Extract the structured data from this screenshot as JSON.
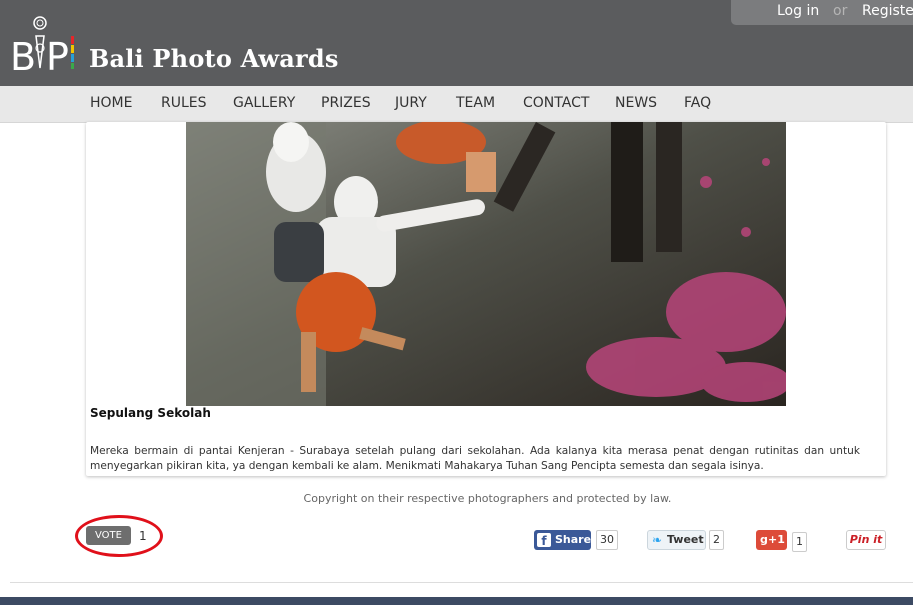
{
  "header": {
    "brand": "Bali Photo Awards",
    "login": "Log in",
    "or": "or",
    "register": "Register"
  },
  "nav": [
    "HOME",
    "RULES",
    "GALLERY",
    "PRIZES",
    "JURY",
    "TEAM",
    "CONTACT",
    "NEWS",
    "FAQ"
  ],
  "photo": {
    "title": "Sepulang Sekolah",
    "description": "Mereka bermain di pantai Kenjeran - Surabaya setelah pulang dari sekolahan. Ada kalanya kita merasa penat dengan rutinitas dan untuk menyegarkan pikiran kita, ya dengan kembali ke alam. Menikmati Mahakarya Tuhan Sang Pencipta semesta dan segala isinya."
  },
  "copyright": "Copyright on their respective photographers and protected by law.",
  "vote": {
    "label": "VOTE",
    "count": "1"
  },
  "social": {
    "facebook": {
      "label": "Share",
      "count": "30"
    },
    "twitter": {
      "label": "Tweet",
      "count": "2"
    },
    "gplus": {
      "label": "+1",
      "count": "1"
    },
    "pinterest": {
      "label": "Pin it"
    }
  },
  "colors": {
    "header": "#5b5c5e",
    "nav": "#e8e8e8",
    "facebook": "#3b5998",
    "gplus": "#dd4b39",
    "pinterest": "#cb2027",
    "vote_ring": "#e0101a"
  }
}
